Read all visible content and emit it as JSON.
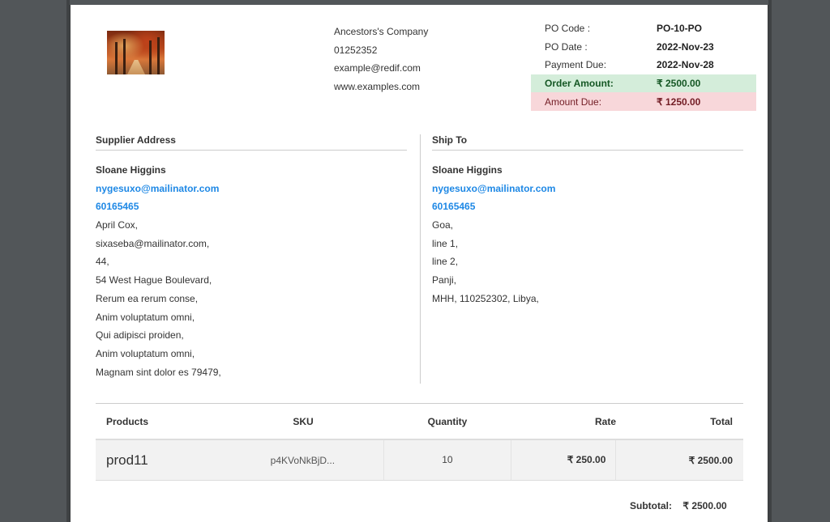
{
  "company": {
    "name": "Ancestors's Company",
    "phone": "01252352",
    "email": "example@redif.com",
    "website": "www.examples.com"
  },
  "po": {
    "code_label": "PO Code :",
    "code": "PO-10-PO",
    "date_label": "PO Date :",
    "date": "2022-Nov-23",
    "due_label": "Payment Due:",
    "due": "2022-Nov-28",
    "order_amount_label": "Order Amount:",
    "order_amount": "₹ 2500.00",
    "amount_due_label": "Amount Due:",
    "amount_due": "₹ 1250.00"
  },
  "supplier": {
    "heading": "Supplier Address",
    "name": "Sloane Higgins",
    "email": "nygesuxo@mailinator.com",
    "phone": "60165465",
    "lines": [
      "April Cox,",
      "sixaseba@mailinator.com,",
      "44,",
      "54 West Hague Boulevard,",
      "Rerum ea rerum conse,",
      "Anim voluptatum omni,",
      "Qui adipisci proiden,",
      "Anim voluptatum omni,",
      "Magnam sint dolor es 79479,"
    ]
  },
  "shipto": {
    "heading": "Ship To",
    "name": "Sloane Higgins",
    "email": "nygesuxo@mailinator.com",
    "phone": "60165465",
    "lines": [
      "Goa,",
      "line 1,",
      "line 2,",
      "Panji,",
      "MHH, 110252302, Libya,"
    ]
  },
  "table": {
    "headers": [
      "Products",
      "SKU",
      "Quantity",
      "Rate",
      "Total"
    ],
    "rows": [
      [
        "prod11",
        "p4KVoNkBjD...",
        "10",
        "₹ 250.00",
        "₹ 2500.00"
      ]
    ]
  },
  "subtotal": {
    "label": "Subtotal:",
    "value": "₹ 2500.00"
  },
  "colors": {
    "order_amount_bg": "#d4edda",
    "amount_due_bg": "#f8d7da",
    "link": "#1e88e5"
  }
}
